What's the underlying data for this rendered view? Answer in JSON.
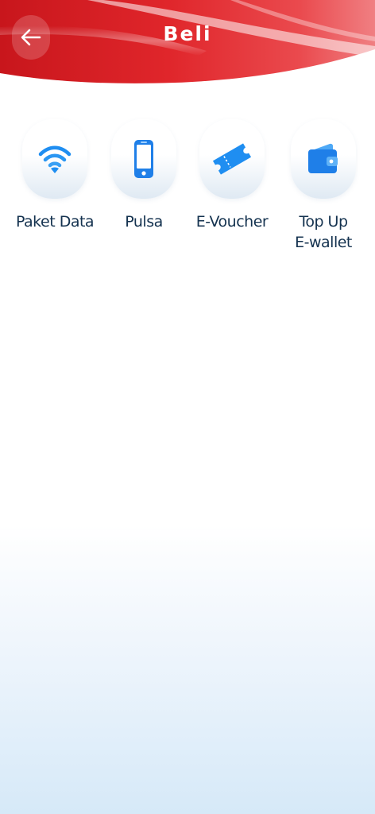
{
  "header": {
    "title": "Beli",
    "back_icon": "arrow-left-icon",
    "accent_color": "#d81e24"
  },
  "menu": {
    "items": [
      {
        "label": "Paket Data",
        "icon": "wifi-icon"
      },
      {
        "label": "Pulsa",
        "icon": "smartphone-icon"
      },
      {
        "label": "E-Voucher",
        "icon": "ticket-icon"
      },
      {
        "label": "Top Up\nE-wallet",
        "icon": "wallet-icon"
      }
    ],
    "icon_color": "#1f8ef1"
  }
}
